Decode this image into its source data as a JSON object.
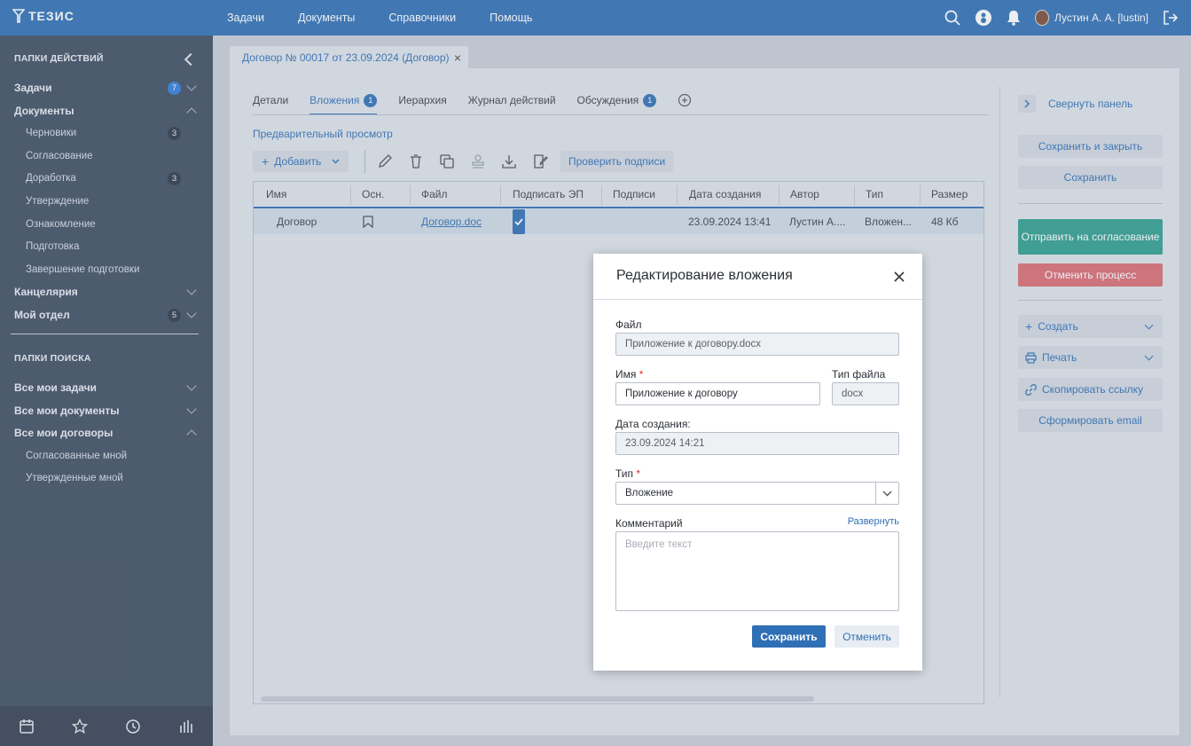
{
  "app": {
    "logo_text": "ТЕЗИС"
  },
  "topnav": [
    "Задачи",
    "Документы",
    "Справочники",
    "Помощь"
  ],
  "user": {
    "name": "Лустин А. А. [lustin]"
  },
  "sidebar": {
    "actions_header": "ПАПКИ ДЕЙСТВИЙ",
    "search_header": "ПАПКИ ПОИСКА",
    "items": [
      {
        "label": "Задачи",
        "badge": "7"
      },
      {
        "label": "Документы"
      },
      {
        "label": "Черновики",
        "badge": "3"
      },
      {
        "label": "Согласование"
      },
      {
        "label": "Доработка",
        "badge": "3"
      },
      {
        "label": "Утверждение"
      },
      {
        "label": "Ознакомление"
      },
      {
        "label": "Подготовка"
      },
      {
        "label": "Завершение подготовки"
      },
      {
        "label": "Канцелярия"
      },
      {
        "label": "Мой отдел",
        "badge": "5"
      }
    ],
    "search_items": [
      {
        "label": "Все мои задачи"
      },
      {
        "label": "Все мои документы"
      },
      {
        "label": "Все мои договоры"
      },
      {
        "label": "Согласованные мной"
      },
      {
        "label": "Утвержденные мной"
      }
    ]
  },
  "doc_tab": {
    "title": "Договор № 00017 от 23.09.2024 (Договор)"
  },
  "tabs": [
    {
      "label": "Детали"
    },
    {
      "label": "Вложения",
      "badge": "1"
    },
    {
      "label": "Иерархия"
    },
    {
      "label": "Журнал действий"
    },
    {
      "label": "Обсуждения",
      "badge": "1"
    }
  ],
  "attachments": {
    "preview_link": "Предварительный просмотр",
    "add_label": "Добавить",
    "check_signatures_label": "Проверить подписи",
    "columns": [
      "Имя",
      "Осн.",
      "Файл",
      "Подписать ЭП",
      "Подписи",
      "Дата создания",
      "Автор",
      "Тип",
      "Размер"
    ],
    "rows": [
      {
        "name": "Договор",
        "file": "Договор.doc",
        "sign": true,
        "signatures": "",
        "created": "23.09.2024 13:41",
        "author": "Лустин А....",
        "type": "Вложен...",
        "size": "48 Кб"
      }
    ]
  },
  "right_panel": {
    "collapse_label": "Свернуть панель",
    "save_close_label": "Сохранить и закрыть",
    "save_label": "Сохранить",
    "send_label": "Отправить на согласование",
    "cancel_process_label": "Отменить процесс",
    "create_label": "Создать",
    "print_label": "Печать",
    "copy_link_label": "Скопировать ссылку",
    "email_label": "Сформировать email"
  },
  "modal": {
    "title": "Редактирование вложения",
    "file_label": "Файл",
    "file_value": "Приложение к договору.docx",
    "name_label": "Имя",
    "name_value": "Приложение к договору",
    "filetype_label": "Тип файла",
    "filetype_value": "docx",
    "created_label": "Дата создания:",
    "created_value": "23.09.2024 14:21",
    "type_label": "Тип",
    "type_value": "Вложение",
    "comment_label": "Комментарий",
    "expand_label": "Развернуть",
    "comment_placeholder": "Введите текст",
    "save_label": "Сохранить",
    "cancel_label": "Отменить"
  },
  "colors": {
    "brand": "#2f6fb5",
    "sidebar": "#3e4c61",
    "send": "#2e9e8e",
    "cancel_process": "#d96b72"
  }
}
